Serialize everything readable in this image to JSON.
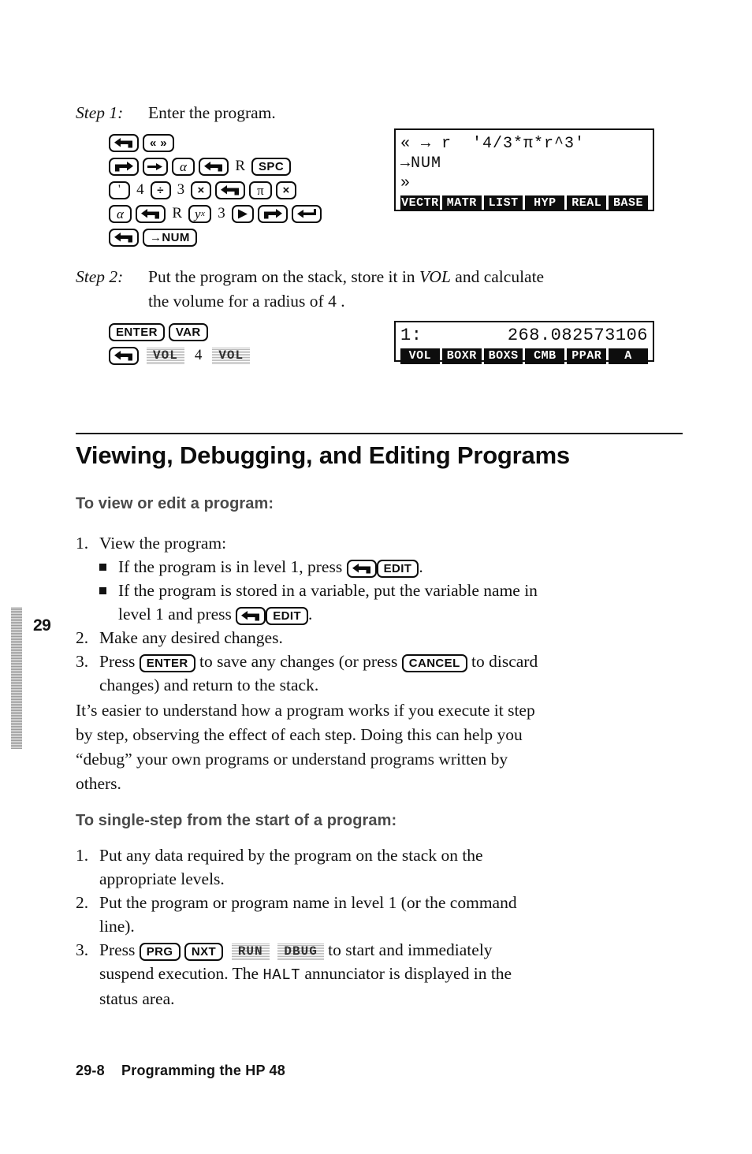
{
  "chapter": {
    "tab_number": "29"
  },
  "footer": {
    "page_number": "29-8",
    "title": "Programming the HP 48"
  },
  "step1": {
    "label": "Step 1:",
    "text": "Enter the program.",
    "keystroke_rows": [
      [
        {
          "type": "key",
          "icon": "left-shift-icon",
          "name": "left-shift-key"
        },
        {
          "type": "key",
          "label": "« »",
          "name": "program-delimiter-key"
        }
      ],
      [
        {
          "type": "key",
          "icon": "right-shift-icon",
          "name": "right-shift-key"
        },
        {
          "type": "key",
          "icon": "arrow-right-icon",
          "name": "local-variable-arrow-key"
        },
        {
          "type": "key",
          "label": "α",
          "name": "alpha-key"
        },
        {
          "type": "key",
          "icon": "left-shift-icon",
          "name": "left-shift-key"
        },
        {
          "type": "char",
          "label": "R",
          "name": "letter-r"
        },
        {
          "type": "key",
          "label": "SPC",
          "name": "space-key"
        }
      ],
      [
        {
          "type": "key",
          "label": "'",
          "name": "tick-quote-key"
        },
        {
          "type": "char",
          "label": "4",
          "name": "digit-4"
        },
        {
          "type": "key",
          "label": "÷",
          "name": "divide-key"
        },
        {
          "type": "char",
          "label": "3",
          "name": "digit-3"
        },
        {
          "type": "key",
          "label": "×",
          "name": "multiply-key"
        },
        {
          "type": "key",
          "icon": "left-shift-icon",
          "name": "left-shift-key"
        },
        {
          "type": "key",
          "label": "π",
          "name": "pi-key"
        },
        {
          "type": "key",
          "label": "×",
          "name": "multiply-key"
        }
      ],
      [
        {
          "type": "key",
          "label": "α",
          "name": "alpha-key"
        },
        {
          "type": "key",
          "icon": "left-shift-icon",
          "name": "left-shift-key"
        },
        {
          "type": "char",
          "label": "R",
          "name": "letter-r"
        },
        {
          "type": "key",
          "label": "y^x",
          "name": "power-key"
        },
        {
          "type": "char",
          "label": "3",
          "name": "digit-3"
        },
        {
          "type": "key",
          "icon": "cursor-right-icon",
          "name": "cursor-right-key"
        },
        {
          "type": "key",
          "icon": "right-shift-icon",
          "name": "right-shift-key"
        },
        {
          "type": "key",
          "icon": "enter-return-icon",
          "name": "enter-key"
        }
      ],
      [
        {
          "type": "key",
          "icon": "left-shift-icon",
          "name": "left-shift-key"
        },
        {
          "type": "key",
          "label": "→NUM",
          "name": "to-num-key"
        }
      ]
    ],
    "display": {
      "lines": [
        "« → r  '4/3*π*r^3'",
        "→NUM",
        "»"
      ],
      "menu": [
        "VECTR",
        "MATR",
        "LIST",
        "HYP",
        "REAL",
        "BASE"
      ]
    }
  },
  "step2": {
    "label": "Step 2:",
    "text_before_vol": "Put the program on the stack, store it in ",
    "vol_italic": "VOL",
    "text_after_vol": " and calculate",
    "text_line2": "the volume for a radius of 4 .",
    "keystroke_rows": [
      [
        {
          "type": "key",
          "label": "ENTER",
          "name": "enter-key"
        },
        {
          "type": "key",
          "label": "VAR",
          "name": "var-key"
        }
      ],
      [
        {
          "type": "key",
          "icon": "left-shift-icon",
          "name": "left-shift-key"
        },
        {
          "type": "menukey",
          "label": "VOL",
          "name": "vol-menu-key"
        },
        {
          "type": "char",
          "label": "4",
          "name": "digit-4"
        },
        {
          "type": "menukey",
          "label": "VOL",
          "name": "vol-menu-key"
        }
      ]
    ],
    "display": {
      "stack_level": "1:",
      "stack_value": "268.082573106",
      "menu": [
        "VOL",
        "BOXR",
        "BOXS",
        "CMB",
        "PPAR",
        "A"
      ]
    }
  },
  "section": {
    "heading": "Viewing, Debugging, and Editing Programs",
    "sub1_heading": "To view or edit a program:",
    "list1": {
      "item1_num": "1.",
      "item1_text": "View the program:",
      "bullet1_before": "If the program is in level 1, press ",
      "bullet1_after": ".",
      "bullet2_line1": "If the program is stored in a variable, put the variable name in",
      "bullet2_line2_before": "level 1 and press ",
      "bullet2_line2_after": ".",
      "edit_key_label": "EDIT",
      "item2_num": "2.",
      "item2_text": "Make any desired changes.",
      "item3_num": "3.",
      "item3_before_enter": "Press ",
      "item3_enter_key": "ENTER",
      "item3_mid": " to save any changes (or press ",
      "item3_cancel_key": "CANCEL",
      "item3_after": " to discard",
      "item3_line2": "changes) and return to the stack."
    },
    "paragraph": [
      "It’s easier to understand how a program works if you execute it step",
      "by step, observing the effect of each step.  Doing this can help you",
      "“debug” your own programs or understand programs written by",
      "others."
    ],
    "sub2_heading": "To single-step from the start of a program:",
    "list2": {
      "item1_num": "1.",
      "item1_line1": "Put any data required by the program on the stack on the",
      "item1_line2": "appropriate levels.",
      "item2_num": "2.",
      "item2_line1": "Put the program or program name in level 1 (or the command",
      "item2_line2": "line).",
      "item3_num": "3.",
      "item3_before": "Press ",
      "item3_prg_key": "PRG",
      "item3_nxt_key": "NXT",
      "item3_run_menukey": "RUN",
      "item3_dbug_menukey": "DBUG",
      "item3_after": " to start and immediately",
      "item3_line2_before": "suspend execution.  The ",
      "item3_halt_mono": "HALT",
      "item3_line2_after": " annunciator is displayed in the",
      "item3_line3": "status area."
    }
  }
}
